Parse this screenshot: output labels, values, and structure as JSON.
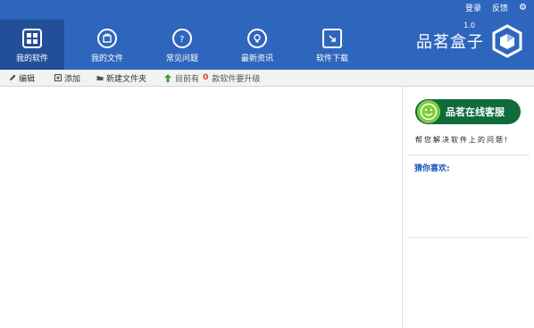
{
  "topbar": {
    "login": "登录",
    "feedback": "反馈",
    "settings_icon": "gear-icon"
  },
  "nav": {
    "items": [
      {
        "label": "我的软件",
        "icon": "my-software-icon",
        "active": true
      },
      {
        "label": "我的文件",
        "icon": "my-files-icon",
        "active": false
      },
      {
        "label": "常见问题",
        "icon": "faq-icon",
        "active": false
      },
      {
        "label": "最新资讯",
        "icon": "news-icon",
        "active": false
      },
      {
        "label": "软件下载",
        "icon": "download-icon",
        "active": false
      }
    ]
  },
  "brand": {
    "name": "品茗盒子",
    "version": "1.0"
  },
  "toolbar": {
    "edit": "编辑",
    "add": "添加",
    "new_folder": "新建文件夹",
    "status_prefix": "目前有",
    "status_count": "0",
    "status_suffix": "款软件要升级"
  },
  "side": {
    "cs_button": "品茗在线客服",
    "tagline": "帮您解决软件上的问题!",
    "recommend_title": "猜你喜欢:"
  },
  "colors": {
    "header": "#2f66bd",
    "accent_green": "#0f6b39",
    "status_red": "#e23c2a"
  }
}
